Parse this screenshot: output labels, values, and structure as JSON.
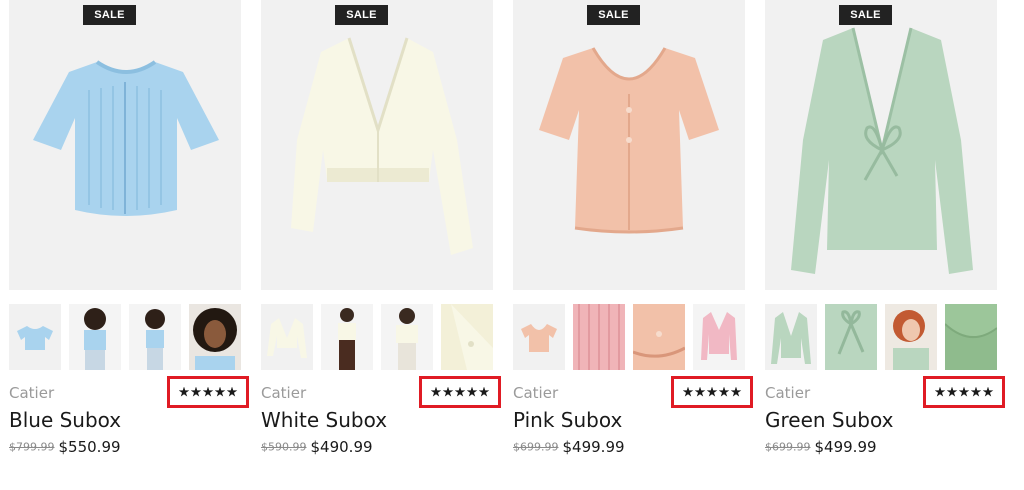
{
  "products": [
    {
      "badge": "SALE",
      "brand": "Catier",
      "name": "Blue Subox",
      "old_price": "$799.99",
      "price": "$550.99",
      "rating": 5,
      "color": "#a9d3ee"
    },
    {
      "badge": "SALE",
      "brand": "Catier",
      "name": "White Subox",
      "old_price": "$590.99",
      "price": "$490.99",
      "rating": 5,
      "color": "#f8f7e6"
    },
    {
      "badge": "SALE",
      "brand": "Catier",
      "name": "Pink Subox",
      "old_price": "$699.99",
      "price": "$499.99",
      "rating": 5,
      "color": "#f2c1a9"
    },
    {
      "badge": "SALE",
      "brand": "Catier",
      "name": "Green Subox",
      "old_price": "$699.99",
      "price": "$499.99",
      "rating": 5,
      "color": "#b9d6bf"
    }
  ],
  "highlight_color": "#e01b24"
}
